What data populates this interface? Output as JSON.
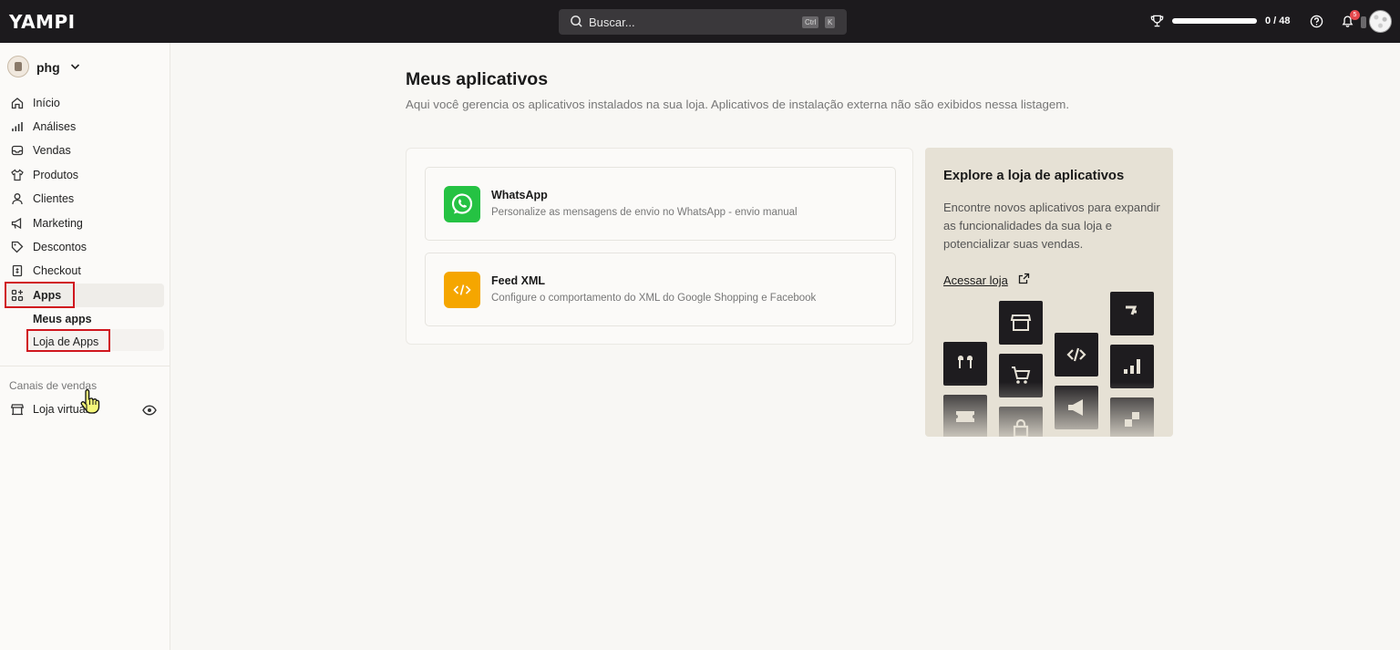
{
  "topbar": {
    "logo": "YAMPI",
    "search_placeholder": "Buscar...",
    "shortcut_ctrl": "Ctrl",
    "shortcut_k": "K",
    "progress_text": "0 / 48",
    "progress_fraction": 0,
    "notification_count": "5"
  },
  "sidebar": {
    "store_name": "phg",
    "items": [
      {
        "label": "Início",
        "icon": "home-icon"
      },
      {
        "label": "Análises",
        "icon": "chart-icon"
      },
      {
        "label": "Vendas",
        "icon": "inbox-icon"
      },
      {
        "label": "Produtos",
        "icon": "shirt-icon"
      },
      {
        "label": "Clientes",
        "icon": "user-icon"
      },
      {
        "label": "Marketing",
        "icon": "megaphone-icon"
      },
      {
        "label": "Descontos",
        "icon": "tag-icon"
      },
      {
        "label": "Checkout",
        "icon": "receipt-icon"
      },
      {
        "label": "Apps",
        "icon": "apps-icon"
      }
    ],
    "sub_items": [
      "Meus apps",
      "Loja de Apps"
    ],
    "section_label": "Canais de vendas",
    "channel": "Loja virtual"
  },
  "main": {
    "title": "Meus aplicativos",
    "subtitle": "Aqui você gerencia os aplicativos instalados na sua loja. Aplicativos de instalação externa não são exibidos nessa listagem.",
    "apps": [
      {
        "name": "WhatsApp",
        "description": "Personalize as mensagens de envio no WhatsApp - envio manual",
        "color": "#25c243"
      },
      {
        "name": "Feed XML",
        "description": "Configure o comportamento do XML do Google Shopping e Facebook",
        "color": "#f5a600"
      }
    ]
  },
  "explore": {
    "title": "Explore a loja de aplicativos",
    "text": "Encontre novos aplicativos para expandir as funcionalidades da sua loja e potencializar suas vendas.",
    "link": "Acessar loja"
  },
  "colors": {
    "topbar": "#1c1a1d",
    "highlight": "#d0161e",
    "explore_bg": "#e6e1d5"
  }
}
